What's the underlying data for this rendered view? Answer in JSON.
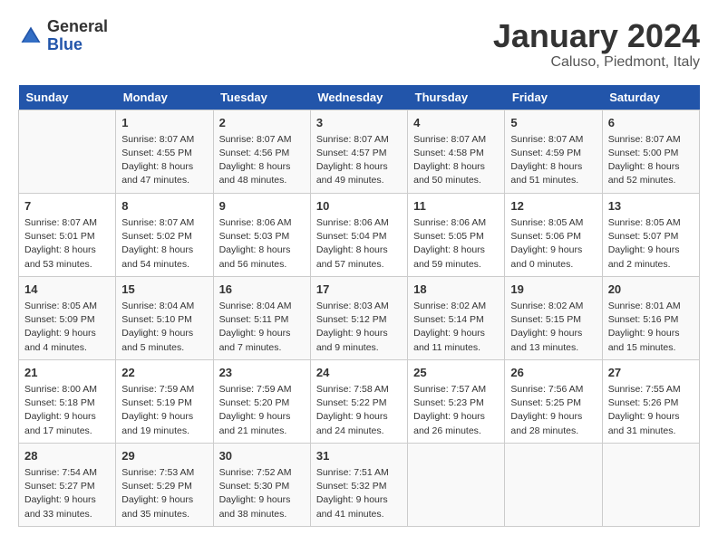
{
  "header": {
    "logo_general": "General",
    "logo_blue": "Blue",
    "title": "January 2024",
    "subtitle": "Caluso, Piedmont, Italy"
  },
  "days_of_week": [
    "Sunday",
    "Monday",
    "Tuesday",
    "Wednesday",
    "Thursday",
    "Friday",
    "Saturday"
  ],
  "weeks": [
    [
      {
        "num": "",
        "detail": ""
      },
      {
        "num": "1",
        "detail": "Sunrise: 8:07 AM\nSunset: 4:55 PM\nDaylight: 8 hours\nand 47 minutes."
      },
      {
        "num": "2",
        "detail": "Sunrise: 8:07 AM\nSunset: 4:56 PM\nDaylight: 8 hours\nand 48 minutes."
      },
      {
        "num": "3",
        "detail": "Sunrise: 8:07 AM\nSunset: 4:57 PM\nDaylight: 8 hours\nand 49 minutes."
      },
      {
        "num": "4",
        "detail": "Sunrise: 8:07 AM\nSunset: 4:58 PM\nDaylight: 8 hours\nand 50 minutes."
      },
      {
        "num": "5",
        "detail": "Sunrise: 8:07 AM\nSunset: 4:59 PM\nDaylight: 8 hours\nand 51 minutes."
      },
      {
        "num": "6",
        "detail": "Sunrise: 8:07 AM\nSunset: 5:00 PM\nDaylight: 8 hours\nand 52 minutes."
      }
    ],
    [
      {
        "num": "7",
        "detail": "Sunrise: 8:07 AM\nSunset: 5:01 PM\nDaylight: 8 hours\nand 53 minutes."
      },
      {
        "num": "8",
        "detail": "Sunrise: 8:07 AM\nSunset: 5:02 PM\nDaylight: 8 hours\nand 54 minutes."
      },
      {
        "num": "9",
        "detail": "Sunrise: 8:06 AM\nSunset: 5:03 PM\nDaylight: 8 hours\nand 56 minutes."
      },
      {
        "num": "10",
        "detail": "Sunrise: 8:06 AM\nSunset: 5:04 PM\nDaylight: 8 hours\nand 57 minutes."
      },
      {
        "num": "11",
        "detail": "Sunrise: 8:06 AM\nSunset: 5:05 PM\nDaylight: 8 hours\nand 59 minutes."
      },
      {
        "num": "12",
        "detail": "Sunrise: 8:05 AM\nSunset: 5:06 PM\nDaylight: 9 hours\nand 0 minutes."
      },
      {
        "num": "13",
        "detail": "Sunrise: 8:05 AM\nSunset: 5:07 PM\nDaylight: 9 hours\nand 2 minutes."
      }
    ],
    [
      {
        "num": "14",
        "detail": "Sunrise: 8:05 AM\nSunset: 5:09 PM\nDaylight: 9 hours\nand 4 minutes."
      },
      {
        "num": "15",
        "detail": "Sunrise: 8:04 AM\nSunset: 5:10 PM\nDaylight: 9 hours\nand 5 minutes."
      },
      {
        "num": "16",
        "detail": "Sunrise: 8:04 AM\nSunset: 5:11 PM\nDaylight: 9 hours\nand 7 minutes."
      },
      {
        "num": "17",
        "detail": "Sunrise: 8:03 AM\nSunset: 5:12 PM\nDaylight: 9 hours\nand 9 minutes."
      },
      {
        "num": "18",
        "detail": "Sunrise: 8:02 AM\nSunset: 5:14 PM\nDaylight: 9 hours\nand 11 minutes."
      },
      {
        "num": "19",
        "detail": "Sunrise: 8:02 AM\nSunset: 5:15 PM\nDaylight: 9 hours\nand 13 minutes."
      },
      {
        "num": "20",
        "detail": "Sunrise: 8:01 AM\nSunset: 5:16 PM\nDaylight: 9 hours\nand 15 minutes."
      }
    ],
    [
      {
        "num": "21",
        "detail": "Sunrise: 8:00 AM\nSunset: 5:18 PM\nDaylight: 9 hours\nand 17 minutes."
      },
      {
        "num": "22",
        "detail": "Sunrise: 7:59 AM\nSunset: 5:19 PM\nDaylight: 9 hours\nand 19 minutes."
      },
      {
        "num": "23",
        "detail": "Sunrise: 7:59 AM\nSunset: 5:20 PM\nDaylight: 9 hours\nand 21 minutes."
      },
      {
        "num": "24",
        "detail": "Sunrise: 7:58 AM\nSunset: 5:22 PM\nDaylight: 9 hours\nand 24 minutes."
      },
      {
        "num": "25",
        "detail": "Sunrise: 7:57 AM\nSunset: 5:23 PM\nDaylight: 9 hours\nand 26 minutes."
      },
      {
        "num": "26",
        "detail": "Sunrise: 7:56 AM\nSunset: 5:25 PM\nDaylight: 9 hours\nand 28 minutes."
      },
      {
        "num": "27",
        "detail": "Sunrise: 7:55 AM\nSunset: 5:26 PM\nDaylight: 9 hours\nand 31 minutes."
      }
    ],
    [
      {
        "num": "28",
        "detail": "Sunrise: 7:54 AM\nSunset: 5:27 PM\nDaylight: 9 hours\nand 33 minutes."
      },
      {
        "num": "29",
        "detail": "Sunrise: 7:53 AM\nSunset: 5:29 PM\nDaylight: 9 hours\nand 35 minutes."
      },
      {
        "num": "30",
        "detail": "Sunrise: 7:52 AM\nSunset: 5:30 PM\nDaylight: 9 hours\nand 38 minutes."
      },
      {
        "num": "31",
        "detail": "Sunrise: 7:51 AM\nSunset: 5:32 PM\nDaylight: 9 hours\nand 41 minutes."
      },
      {
        "num": "",
        "detail": ""
      },
      {
        "num": "",
        "detail": ""
      },
      {
        "num": "",
        "detail": ""
      }
    ]
  ]
}
